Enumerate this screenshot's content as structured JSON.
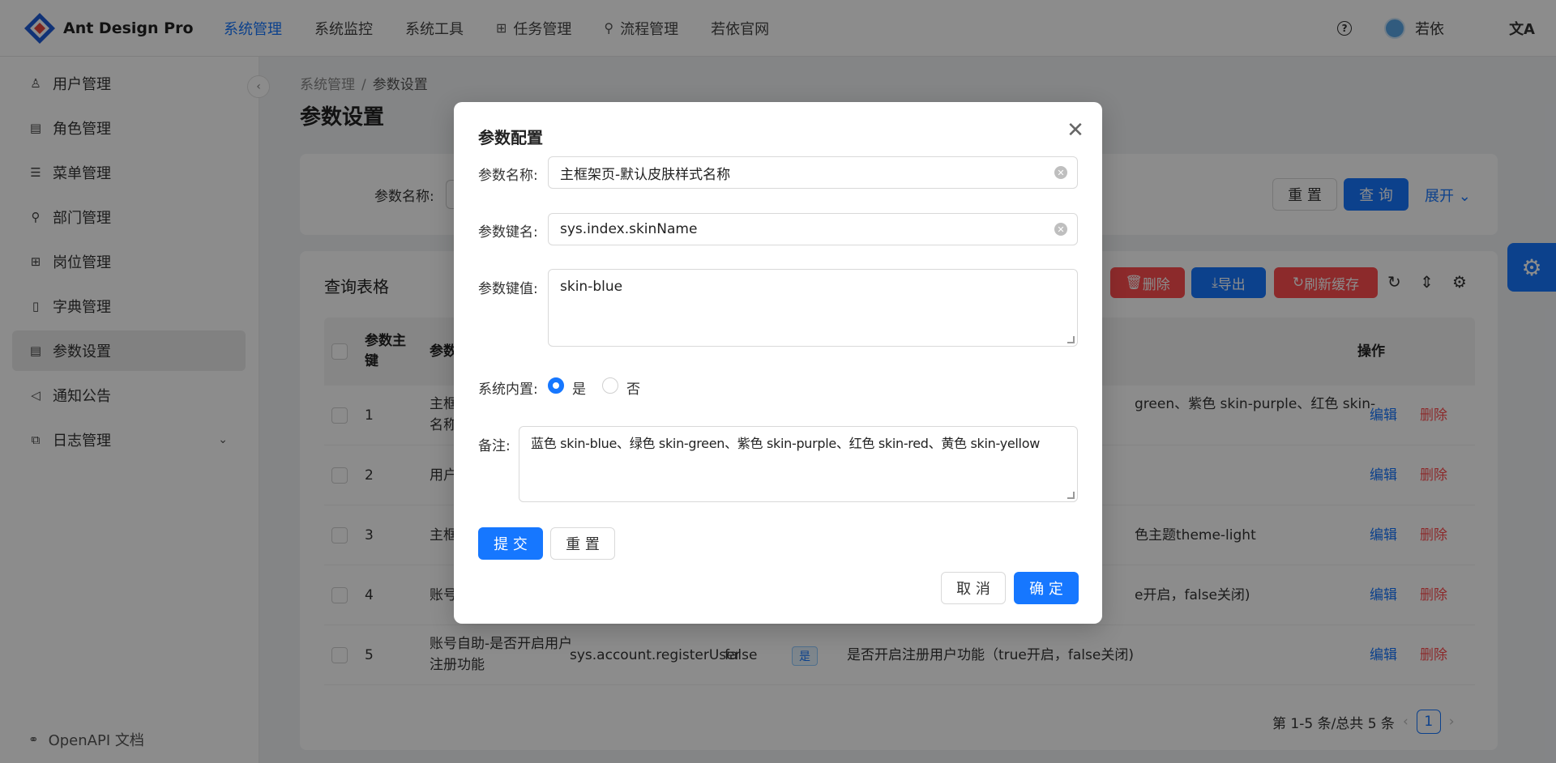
{
  "header": {
    "logo_text": "Ant Design Pro",
    "nav": [
      {
        "label": "系统管理",
        "active": true
      },
      {
        "label": "系统监控"
      },
      {
        "label": "系统工具"
      },
      {
        "label": "任务管理"
      },
      {
        "label": "流程管理"
      },
      {
        "label": "若依官网"
      }
    ],
    "username": "若依"
  },
  "sidebar": {
    "items": [
      {
        "label": "用户管理",
        "icon": "user-icon"
      },
      {
        "label": "角色管理",
        "icon": "role-icon"
      },
      {
        "label": "菜单管理",
        "icon": "menu-icon"
      },
      {
        "label": "部门管理",
        "icon": "dept-icon"
      },
      {
        "label": "岗位管理",
        "icon": "post-icon"
      },
      {
        "label": "字典管理",
        "icon": "book-icon"
      },
      {
        "label": "参数设置",
        "icon": "settings-list-icon",
        "active": true
      },
      {
        "label": "通知公告",
        "icon": "notice-icon"
      },
      {
        "label": "日志管理",
        "icon": "log-icon"
      }
    ],
    "openapi": "OpenAPI 文档"
  },
  "breadcrumb": {
    "parent": "系统管理",
    "current": "参数设置"
  },
  "page_title": "参数设置",
  "search": {
    "label": "参数名称:",
    "reset": "重 置",
    "query": "查 询",
    "expand": "展开"
  },
  "table": {
    "title": "查询表格",
    "toolbar": {
      "delete": "删除",
      "export": "导出",
      "refresh_cache": "刷新缓存"
    },
    "headers": {
      "key_line1": "参数主",
      "key_line2": "键",
      "name": "参数",
      "actions": "操作"
    },
    "rows": [
      {
        "id": "1",
        "name": "主框",
        "name2": "名称",
        "remark": "green、紫色 skin-purple、红色 skin-",
        "edit": "编辑",
        "delete": "删除"
      },
      {
        "id": "2",
        "name": "用户",
        "remark": "",
        "edit": "编辑",
        "delete": "删除"
      },
      {
        "id": "3",
        "name": "主框",
        "remark": "色主题theme-light",
        "edit": "编辑",
        "delete": "删除"
      },
      {
        "id": "4",
        "name": "账号",
        "remark": "e开启，false关闭)",
        "edit": "编辑",
        "delete": "删除"
      },
      {
        "id": "5",
        "name": "账号自助-是否开启用户",
        "name2": "注册功能",
        "key": "sys.account.registerUser",
        "value": "false",
        "builtin": "是",
        "remark": "是否开启注册用户功能（true开启，false关闭)",
        "edit": "编辑",
        "delete": "删除"
      }
    ],
    "pagination": {
      "summary": "第 1-5 条/总共 5 条",
      "page": "1"
    }
  },
  "modal": {
    "title": "参数配置",
    "fields": {
      "name_label": "参数名称:",
      "name_value": "主框架页-默认皮肤样式名称",
      "key_label": "参数键名:",
      "key_value": "sys.index.skinName",
      "value_label": "参数键值:",
      "value_value": "skin-blue",
      "builtin_label": "系统内置:",
      "builtin_yes": "是",
      "builtin_no": "否",
      "remark_label": "备注:",
      "remark_value": "蓝色 skin-blue、绿色 skin-green、紫色 skin-purple、红色 skin-red、黄色 skin-yellow"
    },
    "submit": "提 交",
    "reset": "重 置",
    "cancel": "取 消",
    "ok": "确 定"
  },
  "colors": {
    "primary": "#1677ff",
    "danger": "#ff4d4f",
    "mask": "rgba(0,0,0,0.45)"
  }
}
